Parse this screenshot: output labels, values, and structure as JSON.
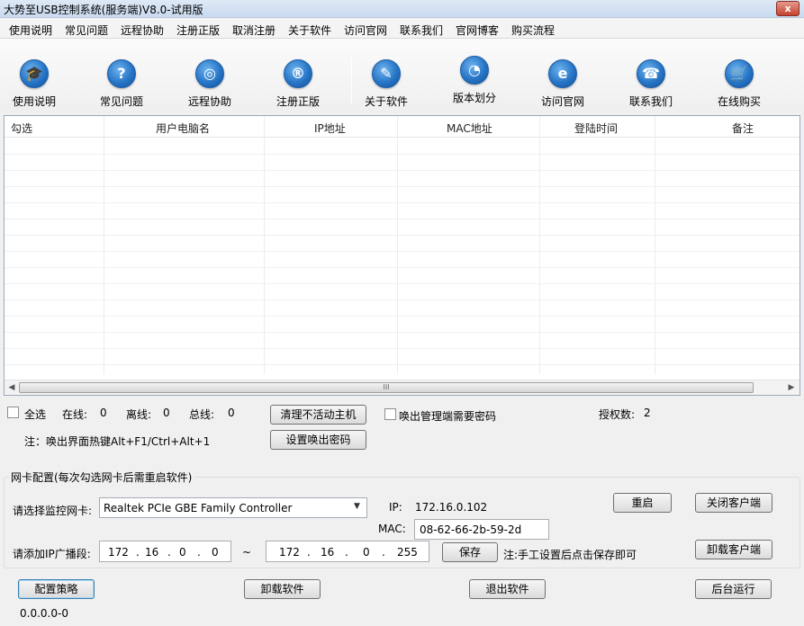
{
  "window": {
    "title": "大势至USB控制系统(服务端)V8.0-试用版",
    "close_glyph": "x"
  },
  "menu": [
    "使用说明",
    "常见问题",
    "远程协助",
    "注册正版",
    "取消注册",
    "关于软件",
    "访问官网",
    "联系我们",
    "官网博客",
    "购买流程"
  ],
  "toolbar": [
    {
      "label": "使用说明",
      "icon": "graduation-cap-icon",
      "glyph": "🎓"
    },
    {
      "label": "常见问题",
      "icon": "question-icon",
      "glyph": "?"
    },
    {
      "label": "远程协助",
      "icon": "globe-hand-icon",
      "glyph": "◎"
    },
    {
      "label": "注册正版",
      "icon": "registered-icon",
      "glyph": "®"
    },
    {
      "label": "关于软件",
      "icon": "document-pen-icon",
      "glyph": "✎"
    },
    {
      "label": "版本划分",
      "icon": "pie-chart-icon",
      "glyph": "◔"
    },
    {
      "label": "访问官网",
      "icon": "ie-browser-icon",
      "glyph": "e"
    },
    {
      "label": "联系我们",
      "icon": "telephone-icon",
      "glyph": "☎"
    },
    {
      "label": "在线购买",
      "icon": "shopping-cart-icon",
      "glyph": "🛒"
    }
  ],
  "table": {
    "columns": [
      "勾选",
      "用户电脑名",
      "IP地址",
      "MAC地址",
      "登陆时间",
      "备注"
    ],
    "rows": [],
    "scroll_thumb_glyph": "III"
  },
  "status": {
    "select_all": "全选",
    "online_label": "在线:",
    "online": "0",
    "offline_label": "离线:",
    "offline": "0",
    "total_label": "总线:",
    "total": "0",
    "clear_inactive": "清理不活动主机",
    "require_password": "唤出管理端需要密码",
    "license_label": "授权数:",
    "license": "2",
    "hotkey_note": "注：唤出界面热键Alt+F1/Ctrl+Alt+1",
    "set_password": "设置唤出密码"
  },
  "nic": {
    "group_title": "网卡配置(每次勾选网卡后需重启软件)",
    "select_label": "请选择监控网卡:",
    "adapter": "Realtek PCIe GBE Family Controller",
    "ip_label": "IP:",
    "ip": "172.16.0.102",
    "mac_label": "MAC:",
    "mac": "08-62-66-2b-59-2d",
    "restart": "重启",
    "close_client": "关闭客户端",
    "uninstall_client": "卸载客户端",
    "broadcast_label": "请添加IP广播段:",
    "ip_from": [
      "172",
      "16",
      "0",
      "0"
    ],
    "range_sep": "~",
    "ip_to": [
      "172",
      "16",
      "0",
      "255"
    ],
    "save": "保存",
    "save_note": "注:手工设置后点击保存即可"
  },
  "footer": {
    "config_policy": "配置策略",
    "uninstall": "卸载软件",
    "exit": "退出软件",
    "background": "后台运行",
    "version": "0.0.0.0-0"
  }
}
